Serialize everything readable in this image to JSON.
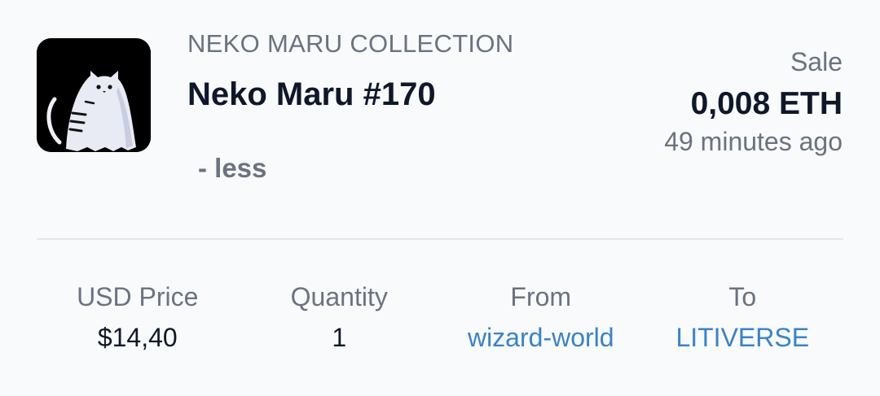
{
  "item": {
    "collection": "NEKO MARU COLLECTION",
    "title": "Neko Maru #170",
    "toggle_label": "- less",
    "image_icon": "ghost-cat-icon"
  },
  "event": {
    "type": "Sale",
    "price": "0,008 ETH",
    "time": "49 minutes ago"
  },
  "details": {
    "usd_label": "USD Price",
    "usd_value": "$14,40",
    "quantity_label": "Quantity",
    "quantity_value": "1",
    "from_label": "From",
    "from_value": "wizard-world",
    "to_label": "To",
    "to_value": "LITIVERSE"
  },
  "colors": {
    "background": "#f8fafc",
    "text_primary": "#0f172a",
    "text_muted": "#6b7280",
    "link": "#3b82c6",
    "divider": "#e5e7eb"
  }
}
